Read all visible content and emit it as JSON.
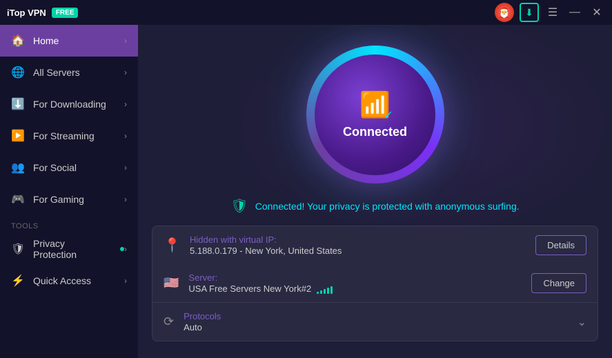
{
  "app": {
    "title": "iTop VPN",
    "badge": "FREE"
  },
  "titleBar": {
    "minimize": "—",
    "maximize": "□",
    "close": "✕"
  },
  "sidebar": {
    "items": [
      {
        "id": "home",
        "label": "Home",
        "icon": "🏠",
        "active": true,
        "hasChevron": true
      },
      {
        "id": "all-servers",
        "label": "All Servers",
        "icon": "🌐",
        "active": false,
        "hasChevron": true
      },
      {
        "id": "for-downloading",
        "label": "For Downloading",
        "icon": "⬇️",
        "active": false,
        "hasChevron": true
      },
      {
        "id": "for-streaming",
        "label": "For Streaming",
        "icon": "📺",
        "active": false,
        "hasChevron": true
      },
      {
        "id": "for-social",
        "label": "For Social",
        "icon": "👥",
        "active": false,
        "hasChevron": true
      },
      {
        "id": "for-gaming",
        "label": "For Gaming",
        "icon": "🎮",
        "active": false,
        "hasChevron": true
      }
    ],
    "toolsSection": {
      "label": "Tools",
      "items": [
        {
          "id": "privacy-protection",
          "label": "Privacy Protection",
          "icon": "🛡",
          "active": false,
          "hasDot": true,
          "hasChevron": true
        },
        {
          "id": "quick-access",
          "label": "Quick Access",
          "icon": "⚡",
          "active": false,
          "hasChevron": true
        }
      ]
    }
  },
  "vpnStatus": {
    "connected": true,
    "label": "Connected",
    "statusMessage": "Connected! Your privacy is protected with anonymous surfing."
  },
  "infoCards": {
    "virtualIp": {
      "label": "Hidden with virtual IP:",
      "value": "5.188.0.179 - New York, United States",
      "buttonLabel": "Details"
    },
    "server": {
      "label": "Server:",
      "value": "USA Free Servers New York#2",
      "flag": "🇺🇸",
      "buttonLabel": "Change",
      "signalBars": [
        3,
        5,
        7,
        9,
        11
      ]
    },
    "protocols": {
      "label": "Protocols",
      "value": "Auto"
    }
  }
}
